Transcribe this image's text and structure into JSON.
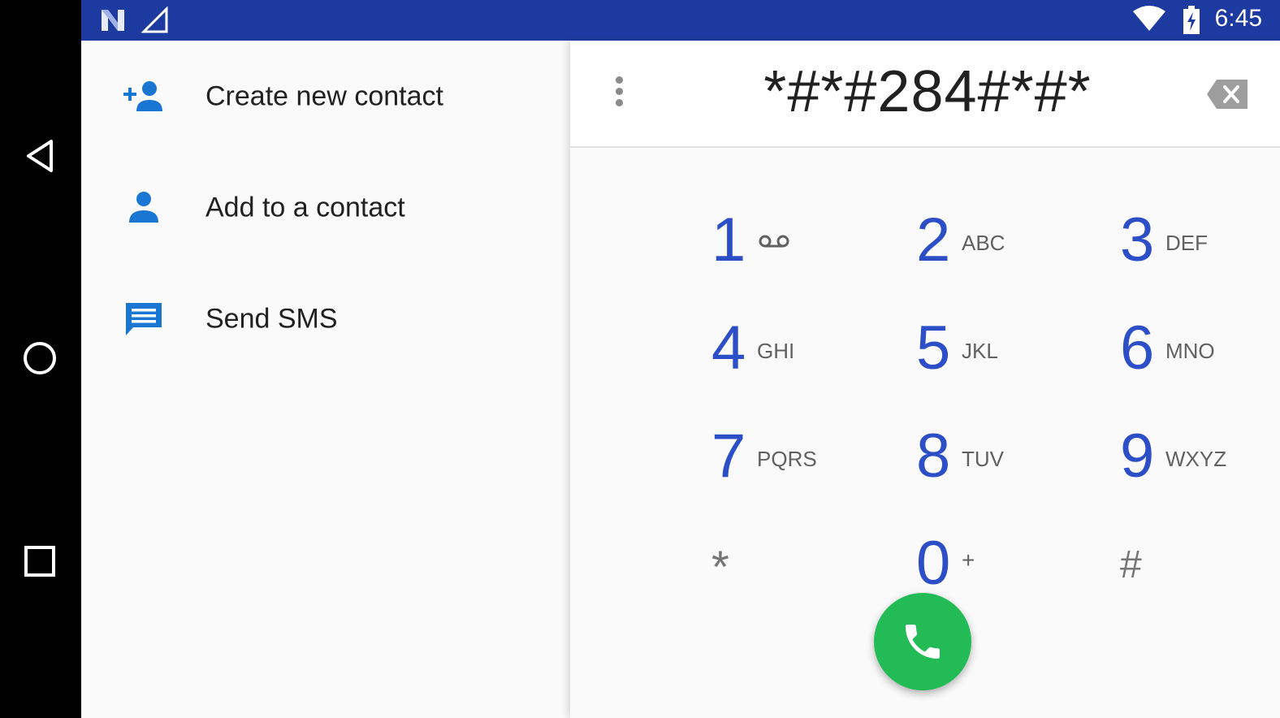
{
  "status_bar": {
    "time": "6:45",
    "icons": [
      "n-notification-icon",
      "signal-icon",
      "wifi-icon",
      "battery-charging-icon"
    ]
  },
  "nav_bar": {
    "buttons": [
      "back-icon",
      "home-icon",
      "recents-icon"
    ]
  },
  "actions": [
    {
      "label": "Create new contact",
      "icon": "add-person-icon"
    },
    {
      "label": "Add to a contact",
      "icon": "person-icon"
    },
    {
      "label": "Send SMS",
      "icon": "message-icon"
    }
  ],
  "dialer": {
    "digits": "*#*#284#*#*",
    "keys": [
      {
        "num": "1",
        "sub": "",
        "sub_icon": "voicemail-icon"
      },
      {
        "num": "2",
        "sub": "ABC"
      },
      {
        "num": "3",
        "sub": "DEF"
      },
      {
        "num": "4",
        "sub": "GHI"
      },
      {
        "num": "5",
        "sub": "JKL"
      },
      {
        "num": "6",
        "sub": "MNO"
      },
      {
        "num": "7",
        "sub": "PQRS"
      },
      {
        "num": "8",
        "sub": "TUV"
      },
      {
        "num": "9",
        "sub": "WXYZ"
      },
      {
        "num": "*",
        "sub": ""
      },
      {
        "num": "0",
        "sub": "+"
      },
      {
        "num": "#",
        "sub": ""
      }
    ]
  },
  "colors": {
    "status_bar": "#1c3aa0",
    "accent_blue": "#2c4ec7",
    "action_icon": "#1976d2",
    "call_button": "#22bb55"
  }
}
